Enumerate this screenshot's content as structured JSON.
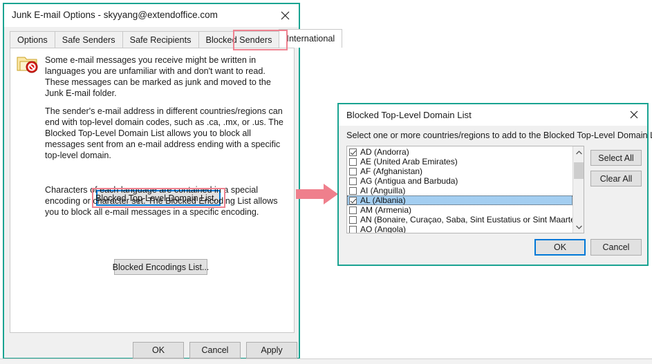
{
  "dialog1": {
    "title": "Junk E-mail Options - skyyang@extendoffice.com",
    "close_icon": "close-icon",
    "tabs": [
      {
        "label": "Options",
        "active": false
      },
      {
        "label": "Safe Senders",
        "active": false
      },
      {
        "label": "Safe Recipients",
        "active": false
      },
      {
        "label": "Blocked Senders",
        "active": false
      },
      {
        "label": "International",
        "active": true
      }
    ],
    "icon": "blocked-folder-icon",
    "paragraph1": "Some e-mail messages you receive might be written in languages you are unfamiliar with and don't want to read. These messages can be marked as junk and moved to the Junk E-mail folder.",
    "paragraph2": "The sender's e-mail address in different countries/regions can end with top-level domain codes, such as .ca, .mx, or .us. The Blocked Top-Level Domain List allows you to block all messages sent from an e-mail address ending with a specific top-level domain.",
    "blocked_tld_button": "Blocked Top-Level Domain List...",
    "paragraph3": "Characters of each language are contained in a special encoding or character set. The Blocked Encoding List allows you to block all e-mail messages in a specific encoding.",
    "blocked_encodings_button": "Blocked Encodings List...",
    "footer": {
      "ok": "OK",
      "cancel": "Cancel",
      "apply": "Apply"
    }
  },
  "dialog2": {
    "title": "Blocked Top-Level Domain List",
    "close_icon": "close-icon",
    "instruction": "Select one or more countries/regions to add to the Blocked Top-Level Domain List.",
    "list_items": [
      {
        "label": "AD (Andorra)",
        "checked": true,
        "selected": false
      },
      {
        "label": "AE (United Arab Emirates)",
        "checked": false,
        "selected": false
      },
      {
        "label": "AF (Afghanistan)",
        "checked": false,
        "selected": false
      },
      {
        "label": "AG (Antigua and Barbuda)",
        "checked": false,
        "selected": false
      },
      {
        "label": "AI (Anguilla)",
        "checked": false,
        "selected": false
      },
      {
        "label": "AL (Albania)",
        "checked": true,
        "selected": true
      },
      {
        "label": "AM (Armenia)",
        "checked": false,
        "selected": false
      },
      {
        "label": "AN (Bonaire, Curaçao, Saba, Sint Eustatius or Sint Maarten)",
        "checked": false,
        "selected": false
      },
      {
        "label": "AO (Angola)",
        "checked": false,
        "selected": false
      }
    ],
    "scrollbar": {
      "up_icon": "chevron-up-icon",
      "down_icon": "chevron-down-icon"
    },
    "select_all": "Select All",
    "clear_all": "Clear All",
    "footer": {
      "ok": "OK",
      "cancel": "Cancel"
    }
  },
  "annotations": {
    "arrow_icon": "right-arrow-annotation",
    "highlight_color": "#ef8290",
    "arrow_color": "#ef7f8c",
    "window_border_color": "#19a391",
    "focus_color": "#0078d7",
    "selection_color": "#a3cef1"
  }
}
